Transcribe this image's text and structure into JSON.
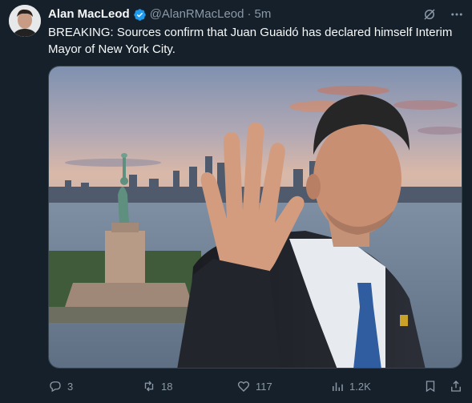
{
  "author": {
    "name": "Alan MacLeod",
    "handle": "@AlanRMacLeod",
    "time": "5m"
  },
  "tweet": {
    "text": "BREAKING: Sources confirm that Juan Guaidó has declared himself Interim Mayor of New York City."
  },
  "actions": {
    "replies": "3",
    "reposts": "18",
    "likes": "117",
    "views": "1.2K"
  },
  "colors": {
    "background": "#15202b",
    "secondary_text": "#8b98a5",
    "verified": "#1d9bf0"
  }
}
